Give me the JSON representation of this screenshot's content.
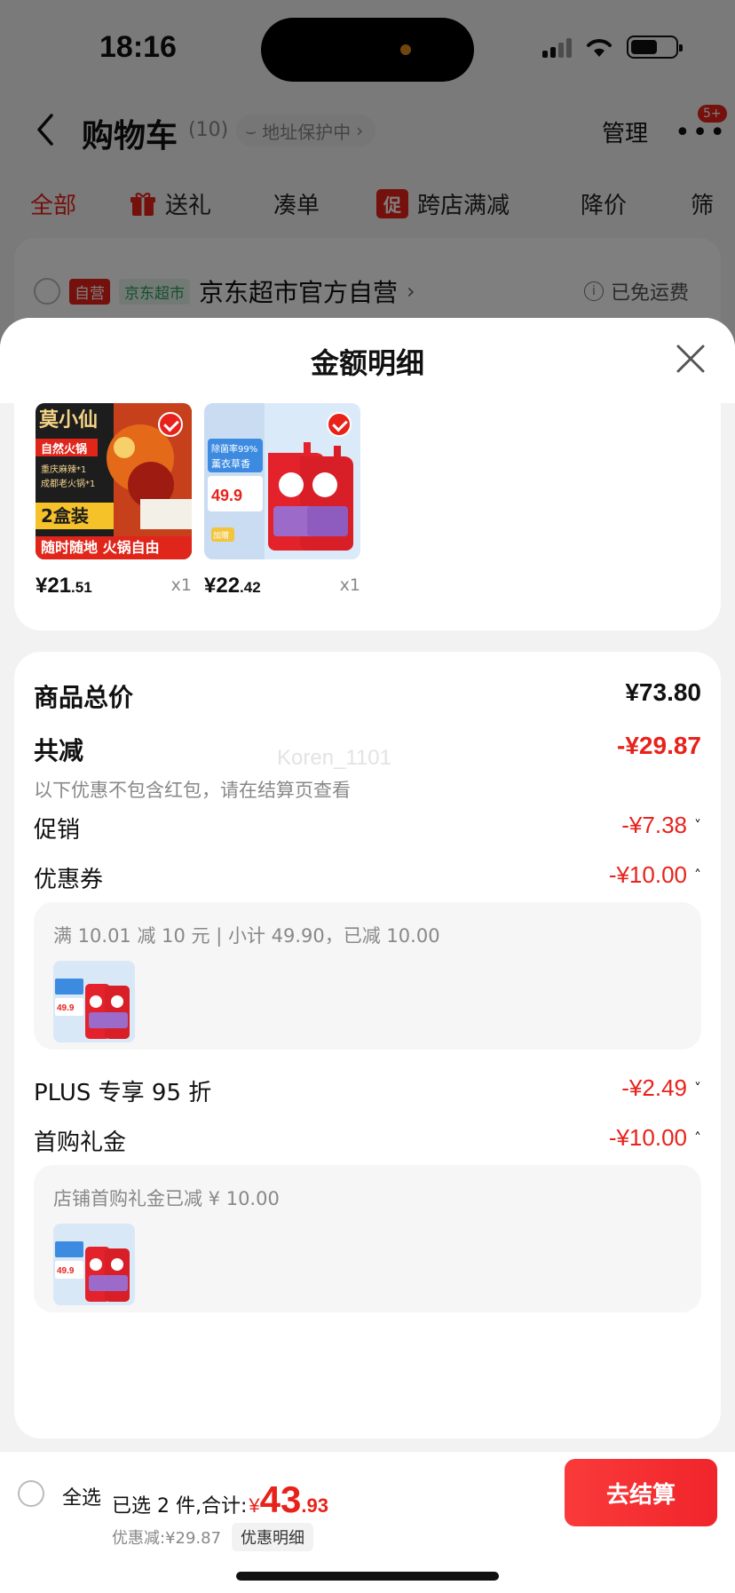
{
  "status_bar": {
    "time": "18:16"
  },
  "nav": {
    "title": "购物车",
    "count": "(10)",
    "address_badge": "地址保护中",
    "manage": "管理",
    "more_badge": "5+"
  },
  "tabs": [
    {
      "label": "全部"
    },
    {
      "label": "送礼"
    },
    {
      "label": "凑单"
    },
    {
      "label": "跨店满减",
      "badge": "促"
    },
    {
      "label": "降价"
    },
    {
      "label": "筛"
    }
  ],
  "store": {
    "tag_self": "自营",
    "tag_jd": "京东超市",
    "name": "京东超市官方自营",
    "shipping": "已免运费"
  },
  "sheet": {
    "title": "金额明细"
  },
  "products": [
    {
      "price_int": "¥21",
      "price_dec": ".51",
      "qty": "x1"
    },
    {
      "price_int": "¥22",
      "price_dec": ".42",
      "qty": "x1"
    }
  ],
  "product_art": {
    "hotpot": {
      "brand": "莫小仙",
      "line1": "自然火锅",
      "line2": "重庆麻辣*1",
      "line3": "成都老火锅*1",
      "badge": "2盒装",
      "footer": "随时随地 火锅自由"
    },
    "detergent": {
      "tag1": "除菌率99%",
      "tag2": "薰衣草香",
      "price": "49.9",
      "sticker": "加赠"
    }
  },
  "summary": {
    "total_label": "商品总价",
    "total_value": "¥73.80",
    "reduce_label": "共减",
    "reduce_value": "-¥29.87",
    "reduce_note": "以下优惠不包含红包，请在结算页查看",
    "watermark": "Koren_1101",
    "promo_label": "促销",
    "promo_value": "-¥7.38",
    "coupon_label": "优惠券",
    "coupon_value": "-¥10.00",
    "coupon_detail": "满 10.01 减 10 元 | 小计 49.90，已减 10.00",
    "plus_label": "PLUS 专享 95 折",
    "plus_value": "-¥2.49",
    "first_label": "首购礼金",
    "first_value": "-¥10.00",
    "first_detail": "店铺首购礼金已减 ¥ 10.00"
  },
  "bottom": {
    "select_all": "全选",
    "selected_text": "已选 2 件,合计:",
    "total_symbol": "¥",
    "total_int": "43",
    "total_dec": ".93",
    "discount_text": "优惠减:¥29.87",
    "detail_button": "优惠明细",
    "checkout": "去结算"
  },
  "colors": {
    "accent": "#e8221b",
    "sheet_bg": "#f2f2f2"
  }
}
